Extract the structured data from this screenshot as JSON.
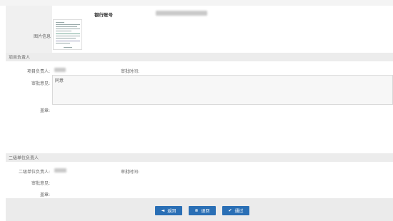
{
  "header": {
    "bank_account_label": "银行账号",
    "image_info_label": "图片信息"
  },
  "project_leader_section": {
    "title": "项目负责人",
    "leader_label": "项目负责人:",
    "review_time_label": "审批时间:",
    "opinion_label": "审批意见:",
    "opinion_value": "同意",
    "seal_label": "盖章:"
  },
  "secondary_unit_section": {
    "title": "二级单位负责人",
    "leader_label": "二级单位负责人:",
    "review_time_label": "审批时间:",
    "opinion_label": "审批意见:",
    "seal_label": "盖章:"
  },
  "actions": {
    "back_label": "返回",
    "return_label": "退回",
    "approve_label": "通过"
  },
  "colors": {
    "button_bg": "#2a6fb5",
    "section_bg": "#ececec"
  }
}
